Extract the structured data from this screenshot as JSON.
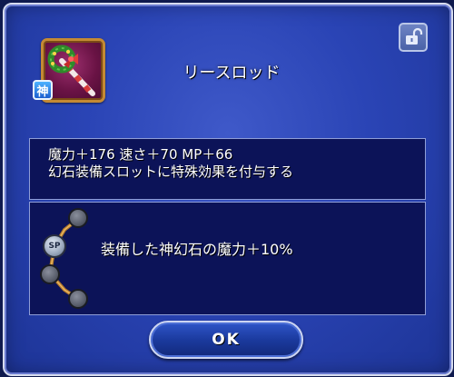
{
  "item": {
    "name": "リースロッド",
    "rarity_badge": "神",
    "icon": "wreath-rod-icon"
  },
  "lock": {
    "icon": "unlocked-padlock-icon"
  },
  "stats": {
    "line1": "魔力＋176 速さ＋70 MP＋66",
    "line2": "幻石装備スロットに特殊効果を付与する"
  },
  "ability": {
    "badge_label": "SP",
    "description": "装備した神幻石の魔力＋10%"
  },
  "ok_button": {
    "label": "OK"
  },
  "colors": {
    "dialog_blue": "#2a44b5",
    "panel_navy": "#0c1358",
    "item_frame_gold": "#c48a34",
    "rarity_blue": "#1d5fcf"
  }
}
